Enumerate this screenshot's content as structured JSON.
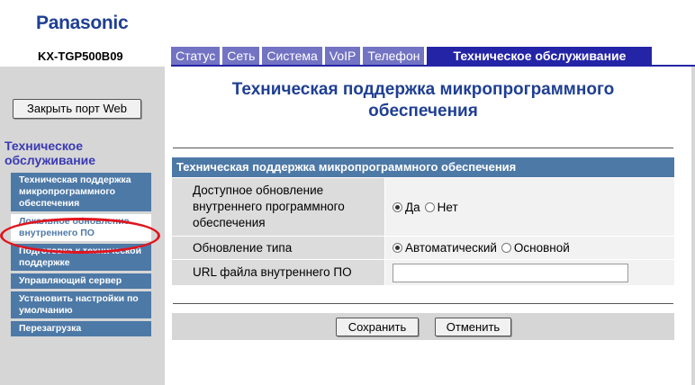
{
  "brand": {
    "logo": "Panasonic",
    "model": "KX-TGP500B09"
  },
  "tabs": [
    {
      "label": "Статус",
      "active": false
    },
    {
      "label": "Сеть",
      "active": false
    },
    {
      "label": "Система",
      "active": false
    },
    {
      "label": "VoIP",
      "active": false
    },
    {
      "label": "Телефон",
      "active": false
    },
    {
      "label": "Техническое обслуживание",
      "active": true
    }
  ],
  "sidebar": {
    "close_port_label": "Закрыть порт Web",
    "section_title": "Техническое обслуживание",
    "items": [
      {
        "label": "Техническая поддержка микропрограммного обеспечения",
        "selected": false
      },
      {
        "label": "Локальное обновление внутреннего ПО",
        "selected": true
      },
      {
        "label": "Подготовка к технической поддержке",
        "selected": false
      },
      {
        "label": "Управляющий сервер",
        "selected": false
      },
      {
        "label": "Установить настройки по умолчанию",
        "selected": false
      },
      {
        "label": "Перезагрузка",
        "selected": false
      }
    ]
  },
  "main": {
    "page_title": "Техническая поддержка микропрограммного обеспечения",
    "panel_title": "Техническая поддержка микропрограммного обеспечения",
    "rows": {
      "available_update": {
        "label": "Доступное обновление внутреннего программного обеспечения",
        "options": [
          {
            "label": "Да",
            "checked": true
          },
          {
            "label": "Нет",
            "checked": false
          }
        ]
      },
      "update_type": {
        "label": "Обновление типа",
        "options": [
          {
            "label": "Автоматический",
            "checked": true
          },
          {
            "label": "Основной",
            "checked": false
          }
        ]
      },
      "firmware_url": {
        "label": "URL файла внутреннего ПО",
        "value": ""
      }
    },
    "buttons": {
      "save": "Сохранить",
      "cancel": "Отменить"
    }
  },
  "colors": {
    "brand": "#1f3f93",
    "tab": "#7373c4",
    "tab_active": "#2424a7",
    "menu": "#4d79a7",
    "highlight_circle": "#e0141e"
  }
}
